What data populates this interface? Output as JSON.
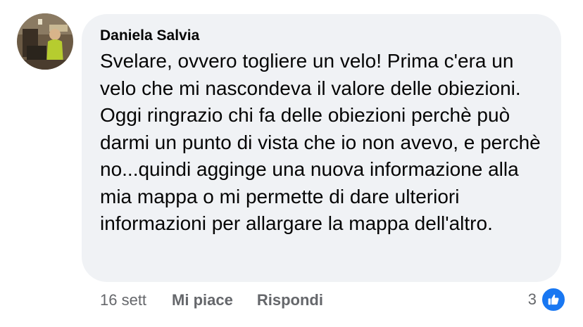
{
  "comment": {
    "author": "Daniela Salvia",
    "text": "Svelare, ovvero togliere un velo! Prima c'era un velo che mi nascondeva il valore delle obiezioni. Oggi ringrazio chi fa delle obiezioni perchè può darmi un punto di vista che io non avevo, e perchè no...quindi agginge una nuova informazione alla mia mappa o mi permette di dare ulteriori informazioni per allargare la mappa dell'altro.",
    "timestamp": "16 sett",
    "like_label": "Mi piace",
    "reply_label": "Rispondi",
    "reaction_count": "3",
    "reaction_icon": "thumbs-up-icon",
    "reaction_color": "#1877f2",
    "bubble_color": "#f0f2f5",
    "muted_text_color": "#65676b"
  }
}
